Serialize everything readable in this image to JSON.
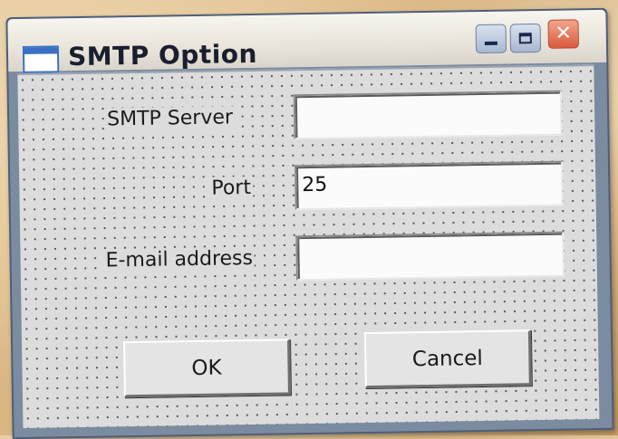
{
  "window": {
    "title": "SMTP Option"
  },
  "controls": {
    "close_glyph": "✕"
  },
  "form": {
    "smtp_server_label": "SMTP Server",
    "smtp_server_value": "",
    "port_label": "Port",
    "port_value": "25",
    "email_label": "E-mail address",
    "email_value": ""
  },
  "buttons": {
    "ok_label": "OK",
    "cancel_label": "Cancel"
  },
  "icons": {
    "app": "window-icon",
    "minimize": "minimize-icon",
    "maximize": "maximize-icon",
    "close": "close-icon"
  },
  "colors": {
    "titlebar": "#e8e4da",
    "close_button": "#d95a3c",
    "client_bg": "#dcdcdc"
  }
}
